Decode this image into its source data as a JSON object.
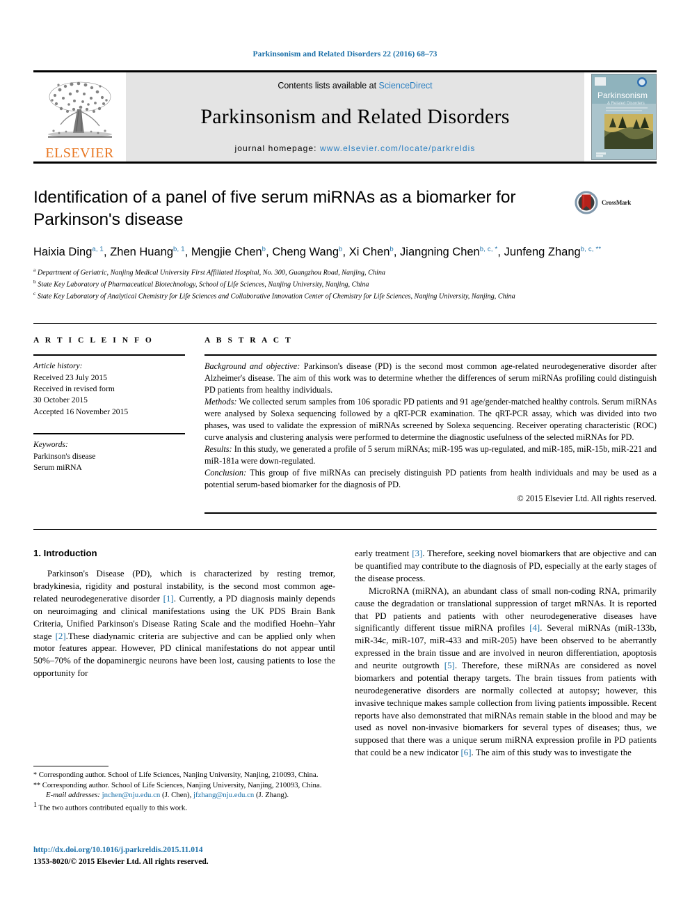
{
  "running_head": "Parkinsonism and Related Disorders 22 (2016) 68–73",
  "masthead": {
    "publisher_name": "ELSEVIER",
    "contents_prefix": "Contents lists available at ",
    "contents_link": "ScienceDirect",
    "journal_title": "Parkinsonism and Related Disorders",
    "homepage_prefix": "journal homepage: ",
    "homepage_url": "www.elsevier.com/locate/parkreldis",
    "cover_title": "Parkinsonism",
    "cover_subtitle": "& Related Disorders"
  },
  "article": {
    "title": "Identification of a panel of five serum miRNAs as a biomarker for Parkinson's disease",
    "crossmark_label": "CrossMark",
    "authors_line_1": "Haixia Ding",
    "authors": [
      {
        "name": "Haixia Ding",
        "sup": "a, 1",
        "sep": ", "
      },
      {
        "name": "Zhen Huang",
        "sup": "b, 1",
        "sep": ", "
      },
      {
        "name": "Mengjie Chen",
        "sup": "b",
        "sep": ", "
      },
      {
        "name": "Cheng Wang",
        "sup": "b",
        "sep": ", "
      },
      {
        "name": "Xi Chen",
        "sup": "b",
        "sep": ", "
      },
      {
        "name": "Jiangning Chen",
        "sup": "b, c, *",
        "sep": ", "
      },
      {
        "name": "Junfeng Zhang",
        "sup": "b, c, **",
        "sep": ""
      }
    ],
    "affiliations": [
      {
        "mark": "a",
        "text": "Department of Geriatric, Nanjing Medical University First Affiliated Hospital, No. 300, Guangzhou Road, Nanjing, China"
      },
      {
        "mark": "b",
        "text": "State Key Laboratory of Pharmaceutical Biotechnology, School of Life Sciences, Nanjing University, Nanjing, China"
      },
      {
        "mark": "c",
        "text": "State Key Laboratory of Analytical Chemistry for Life Sciences and Collaborative Innovation Center of Chemistry for Life Sciences, Nanjing University, Nanjing, China"
      }
    ]
  },
  "article_info": {
    "heading": "A R T I C L E   I N F O",
    "history_label": "Article history:",
    "history": [
      "Received 23 July 2015",
      "Received in revised form",
      "30 October 2015",
      "Accepted 16 November 2015"
    ],
    "keywords_label": "Keywords:",
    "keywords": [
      "Parkinson's disease",
      "Serum miRNA"
    ]
  },
  "abstract": {
    "heading": "A B S T R A C T",
    "background_label": "Background and objective:",
    "background_text": " Parkinson's disease (PD) is the second most common age-related neurodegenerative disorder after Alzheimer's disease. The aim of this work was to determine whether the differences of serum miRNAs profiling could distinguish PD patients from healthy individuals.",
    "methods_label": "Methods:",
    "methods_text": " We collected serum samples from 106 sporadic PD patients and 91 age/gender-matched healthy controls. Serum miRNAs were analysed by Solexa sequencing followed by a qRT-PCR examination. The qRT-PCR assay, which was divided into two phases, was used to validate the expression of miRNAs screened by Solexa sequencing. Receiver operating characteristic (ROC) curve analysis and clustering analysis were performed to determine the diagnostic usefulness of the selected miRNAs for PD.",
    "results_label": "Results:",
    "results_text": " In this study, we generated a profile of 5 serum miRNAs; miR-195 was up-regulated, and miR-185, miR-15b, miR-221 and miR-181a were down-regulated.",
    "conclusion_label": "Conclusion:",
    "conclusion_text": " This group of five miRNAs can precisely distinguish PD patients from health individuals and may be used as a potential serum-based biomarker for the diagnosis of PD.",
    "copyright": "© 2015 Elsevier Ltd. All rights reserved."
  },
  "body": {
    "section_number_title": "1.  Introduction",
    "left_para_1_a": "Parkinson's Disease (PD), which is characterized by resting tremor, bradykinesia, rigidity and postural instability, is the second most common age-related neurodegenerative disorder ",
    "left_ref_1": "[1]",
    "left_para_1_b": ". Currently, a PD diagnosis mainly depends on neuroimaging and clinical manifestations using the UK PDS Brain Bank Criteria, Unified Parkinson's Disease Rating Scale and the modified Hoehn–Yahr stage ",
    "left_ref_2": "[2]",
    "left_para_1_c": ".These diadynamic criteria are subjective and can be applied only when motor features appear. However, PD clinical manifestations do not appear until 50%–70% of the dopaminergic neurons have been lost, causing patients to lose the opportunity for",
    "right_para_1_a": "early treatment ",
    "right_ref_3": "[3]",
    "right_para_1_b": ". Therefore, seeking novel biomarkers that are objective and can be quantified may contribute to the diagnosis of PD, especially at the early stages of the disease process.",
    "right_para_2_a": "MicroRNA (miRNA), an abundant class of small non-coding RNA, primarily cause the degradation or translational suppression of target mRNAs. It is reported that PD patients and patients with other neurodegenerative diseases have significantly different tissue miRNA profiles ",
    "right_ref_4": "[4]",
    "right_para_2_b": ". Several miRNAs (miR-133b, miR-34c, miR-107, miR-433 and miR-205) have been observed to be aberrantly expressed in the brain tissue and are involved in neuron differentiation, apoptosis and neurite outgrowth ",
    "right_ref_5": "[5]",
    "right_para_2_c": ". Therefore, these miRNAs are considered as novel biomarkers and potential therapy targets. The brain tissues from patients with neurodegenerative disorders are normally collected at autopsy; however, this invasive technique makes sample collection from living patients impossible. Recent reports have also demonstrated that miRNAs remain stable in the blood and may be used as novel non-invasive biomarkers for several types of diseases; thus, we supposed that there was a unique serum miRNA expression profile in PD patients that could be a new indicator ",
    "right_ref_6": "[6]",
    "right_para_2_d": ". The aim of this study was to investigate the"
  },
  "footnotes": {
    "fn1_mark": "*",
    "fn1_text": " Corresponding author. School of Life Sciences, Nanjing University, Nanjing, 210093, China.",
    "fn2_mark": "**",
    "fn2_text": " Corresponding author. School of Life Sciences, Nanjing University, Nanjing, 210093, China.",
    "email_label": "E-mail addresses:",
    "email_1": "jnchen@nju.edu.cn",
    "email_1_owner": " (J. Chen), ",
    "email_2": "jfzhang@nju.edu.cn",
    "email_2_owner": " (J. Zhang).",
    "fn3_mark": "1",
    "fn3_text": " The two authors contributed equally to this work.",
    "doi": "http://dx.doi.org/10.1016/j.parkreldis.2015.11.014",
    "issn": "1353-8020/© 2015 Elsevier Ltd. All rights reserved."
  },
  "colors": {
    "link_blue": "#1a6fa8",
    "elsevier_orange": "#E87722",
    "masthead_gray": "#e4e4e4",
    "crossmark_red": "#b5211a"
  }
}
